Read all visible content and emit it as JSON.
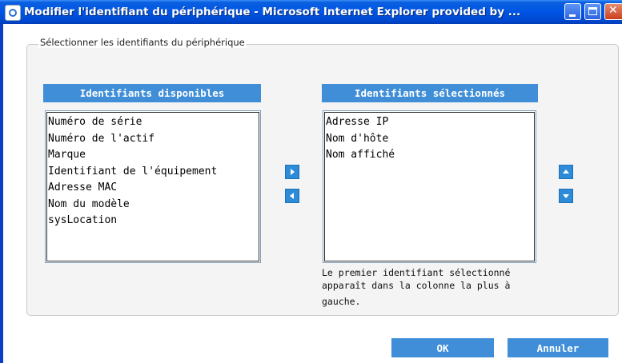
{
  "window": {
    "title": "Modifier l'identifiant du périphérique - Microsoft Internet Explorer provided by ...",
    "icon": "ie-icon"
  },
  "group": {
    "legend": "Sélectionner les identifiants du périphérique"
  },
  "available": {
    "header": "Identifiants disponibles",
    "items": [
      "Numéro de série",
      "Numéro de l'actif",
      "Marque",
      "Identifiant de l'équipement",
      "Adresse MAC",
      "Nom du modèle",
      "sysLocation"
    ]
  },
  "selected": {
    "header": "Identifiants sélectionnés",
    "items": [
      "Adresse IP",
      "Nom d'hôte",
      "Nom affiché"
    ]
  },
  "note": {
    "line1": "Le premier identifiant sélectionné",
    "line2": "apparaît dans la colonne la plus à",
    "line3": "gauche."
  },
  "buttons": {
    "ok": "OK",
    "cancel": "Annuler"
  },
  "colors": {
    "accent": "#3F8ED7",
    "title_bar": "#0055E5"
  }
}
